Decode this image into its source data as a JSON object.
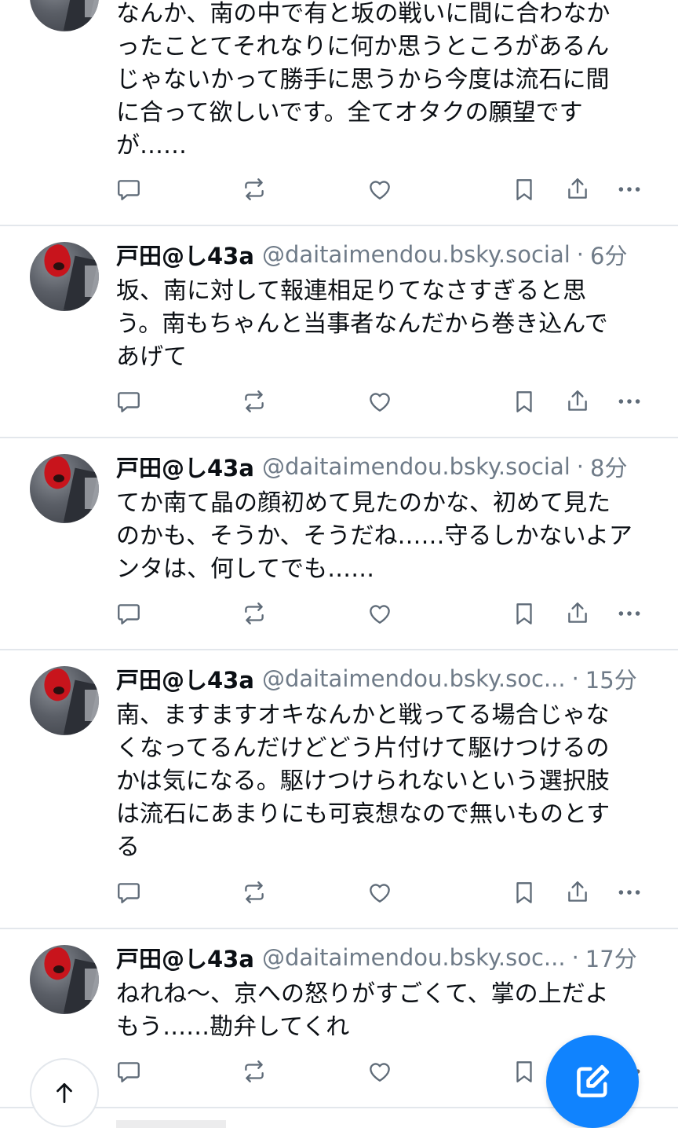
{
  "posts": [
    {
      "text": "なんか、南の中で有と坂の戦いに間に合わなか\nったことてそれなりに何か思うところがあるん\nじゃないかって勝手に思うから今度は流石に間\nに合って欲しいです。全てオタクの願望です\nが……"
    },
    {
      "name": "戸田@し43a",
      "handle": "@daitaimendou.bsky.social",
      "separator": "·",
      "time": "6分",
      "text": "坂、南に対して報連相足りてなさすぎると思\nう。南もちゃんと当事者なんだから巻き込んで\nあげて"
    },
    {
      "name": "戸田@し43a",
      "handle": "@daitaimendou.bsky.social",
      "separator": "·",
      "time": "8分",
      "text": "てか南て晶の顔初めて見たのかな、初めて見た\nのかも、そうか、そうだね……守るしかないよア\nンタは、何してでも……"
    },
    {
      "name": "戸田@し43a",
      "handle": "@daitaimendou.bsky.soc...",
      "separator": "·",
      "time": "15分",
      "text": "南、ますますオキなんかと戦ってる場合じゃな\nくなってるんだけどどう片付けて駆けつけるの\nかは気になる。駆けつけられないという選択肢\nは流石にあまりにも可哀想なので無いものとす\nる"
    },
    {
      "name": "戸田@し43a",
      "handle": "@daitaimendou.bsky.soc...",
      "separator": "·",
      "time": "17分",
      "text": "ねれね〜、京への怒りがすごくて、掌の上だよ\nもう……勘弁してくれ"
    }
  ],
  "icons": {
    "reply": "speech-bubble-icon",
    "repost": "repost-icon",
    "like": "heart-icon",
    "bookmark": "bookmark-icon",
    "share": "share-icon",
    "more": "ellipsis-icon",
    "scroll_top": "arrow-up-icon",
    "compose": "compose-icon"
  },
  "colors": {
    "accent": "#1083fe",
    "muted": "#6f7b88",
    "divider": "#e3e7ec",
    "hair": "#c8141c"
  }
}
